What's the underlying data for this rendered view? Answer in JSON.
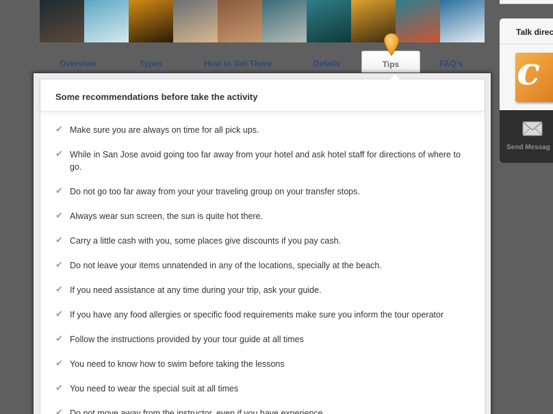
{
  "photos": [
    {
      "name": "surfer-portrait",
      "colors": [
        "#1e2a33",
        "#5a4a3a"
      ]
    },
    {
      "name": "surfer-tube",
      "colors": [
        "#5aa7c4",
        "#d7e9ef"
      ]
    },
    {
      "name": "sunset-surf",
      "colors": [
        "#d38b12",
        "#2a1b0a"
      ]
    },
    {
      "name": "surfer-girl",
      "colors": [
        "#6a6f75",
        "#d9b88f"
      ]
    },
    {
      "name": "boards-closeup",
      "colors": [
        "#8a5a3c",
        "#c99770"
      ]
    },
    {
      "name": "beach-walk",
      "colors": [
        "#3a6c7a",
        "#b7bcb5"
      ]
    },
    {
      "name": "surfer-wave-green",
      "colors": [
        "#2f7e88",
        "#0f3a3a"
      ]
    },
    {
      "name": "silhouette-jump",
      "colors": [
        "#e0a22a",
        "#3a2a12"
      ]
    },
    {
      "name": "surfer-riding",
      "colors": [
        "#2e7e8e",
        "#cc5533"
      ]
    },
    {
      "name": "wave-splash",
      "colors": [
        "#2a6fa0",
        "#e8eef2"
      ]
    }
  ],
  "tabs": {
    "overview": "Overview",
    "types": "Types",
    "how_to_get_there": "How to Get There",
    "details": "Details",
    "tips": "Tips",
    "faqs": "FAQ's"
  },
  "panel": {
    "heading": "Some recommendations before take the activity",
    "tips": [
      "Make sure you are always on time for all pick ups.",
      "While in San Jose avoid going too far away from your hotel and ask hotel staff for directions of where to go.",
      "Do not go too far away from your your traveling group on your transfer stops.",
      "Always wear sun screen, the sun is quite hot there.",
      "Carry a little cash with you, some places give discounts if you pay cash.",
      "Do not leave your items unnatended in any of the locations, specially at the beach.",
      "If you need assistance at any time during your trip, ask your guide.",
      "If you have any food allergies or specific food requirements make sure you inform the tour operator",
      "Follow the instructions provided by your tour guide at all times",
      "You need to know how to swim before taking the lessons",
      "You need to wear the special suit at all times",
      "Do not move away from the instructor, even if you have experience"
    ]
  },
  "sidebar": {
    "title": "Talk direc",
    "send_label": "Send Messag"
  },
  "colors": {
    "pin": "#f5a623",
    "tab_link": "#2a4a80",
    "check": "#9a9a9a"
  }
}
